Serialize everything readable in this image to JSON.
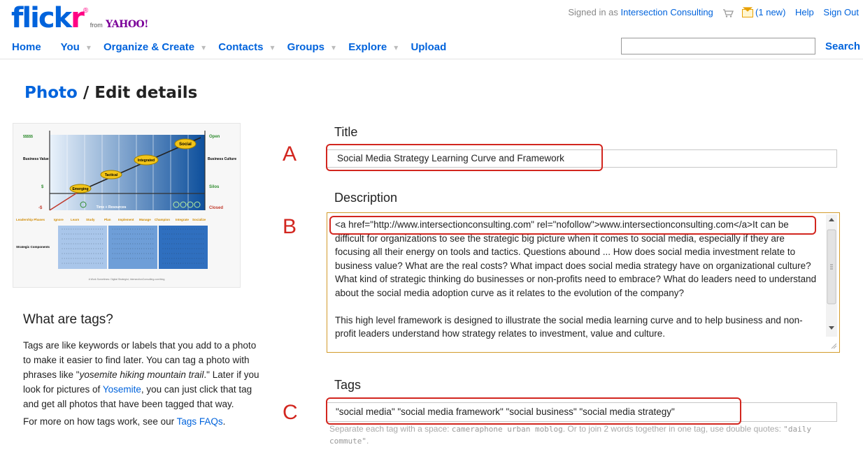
{
  "header": {
    "logo_text": "flickr",
    "logo_r": "r",
    "logo_from": "from",
    "logo_yahoo": "YAHOO!",
    "signed_in_prefix": "Signed in as",
    "username": "Intersection Consulting",
    "mail_label": "(1 new)",
    "help": "Help",
    "sign_out": "Sign Out"
  },
  "nav": {
    "items": [
      "Home",
      "You",
      "Organize & Create",
      "Contacts",
      "Groups",
      "Explore",
      "Upload"
    ],
    "dropdown_glyph": "▾",
    "search_button": "Search",
    "search_value": ""
  },
  "page": {
    "title_link": "Photo",
    "title_sep": " / ",
    "title_rest": "Edit details"
  },
  "thumbnail": {
    "top_values": [
      "$$$$$",
      "Open"
    ],
    "y_left": "Business Value",
    "y_right": "Business Culture",
    "dollar": "$",
    "neg": "-$",
    "silos": "Silos",
    "closed": "Closed",
    "stages": [
      "Emerging",
      "Tactical",
      "Integrated",
      "Social"
    ],
    "x_axis": "Time + Resources",
    "phases_label": "Leadership Phases",
    "phases": [
      "Ignore",
      "Learn",
      "Study",
      "Plan",
      "Implement",
      "Manage",
      "Champion",
      "Integrate",
      "Socialize"
    ],
    "components_label": "Strategic Components",
    "footer": "A Work Sometimes: Digital Strategist, IntersectionConsulting.com/blog"
  },
  "help": {
    "heading": "What are tags?",
    "p1_a": "Tags are like keywords or labels that you add to a photo to make it easier to find later. You can tag a photo with phrases like \"",
    "p1_example": "yosemite hiking mountain trail",
    "p1_b": ".\" Later if you look for pictures of ",
    "p1_link": "Yosemite",
    "p1_c": ", you can just click that tag and get all photos that have been tagged that way.",
    "more_a": "For more on how tags work, see our ",
    "more_link": "Tags FAQs",
    "more_b": "."
  },
  "form": {
    "title_label": "Title",
    "title_value": "Social Media Strategy Learning Curve and Framework",
    "description_label": "Description",
    "description_p1": "<a href=\"http://www.intersectionconsulting.com\" rel=\"nofollow\">www.intersectionconsulting.com</a>It can be difficult for organizations to see the strategic big picture when it comes to social media, especially if they are focusing all their energy on tools and tactics. Questions abound ... How does social media investment relate to business value? What are the real costs? What impact does social media strategy have on organizational culture? What kind of strategic thinking do businesses or non-profits need to embrace? What do leaders need to understand about the social media adoption curve as it relates to the evolution of the company?",
    "description_p2": "This high level framework is designed to illustrate the social media learning curve and to help business and non-profit leaders understand how strategy relates to investment, value and culture.",
    "tags_label": "Tags",
    "tags_value": "\"social media\" \"social media framework\" \"social business\" \"social media strategy\"",
    "hint_a": "Separate each tag with a space: ",
    "hint_code1": "cameraphone urban moblog",
    "hint_b": ". Or to join 2 words together in one tag, use double quotes: ",
    "hint_code2": "\"daily commute\"",
    "hint_c": "."
  },
  "annotations": {
    "A": "A",
    "B": "B",
    "C": "C"
  },
  "colors": {
    "flickr_blue": "#0063dc",
    "flickr_pink": "#ff0084",
    "annotation_red": "#d2261f",
    "textarea_border": "#d39b2b"
  }
}
